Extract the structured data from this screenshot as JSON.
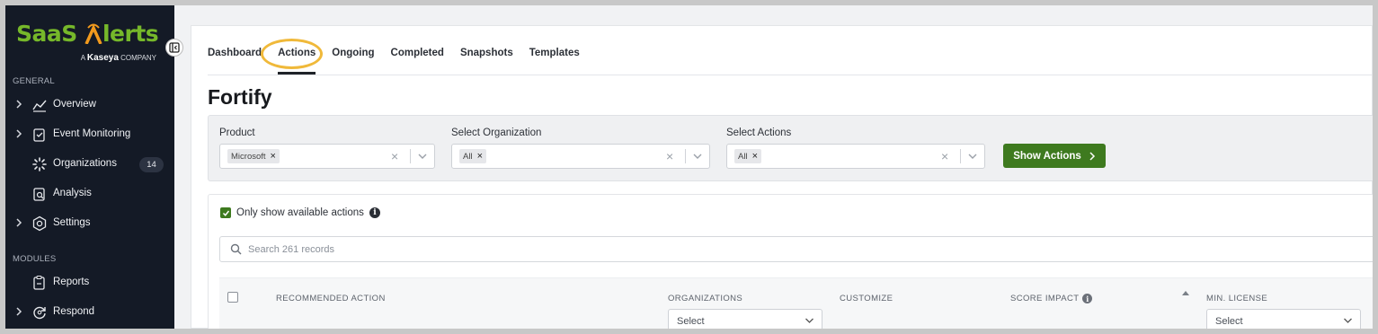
{
  "brand": {
    "name_part1": "SaaS",
    "name_part2": "lerts",
    "tagline_prefix": "A",
    "tagline_company": "Kaseya",
    "tagline_suffix": "COMPANY"
  },
  "sidebar": {
    "sections": {
      "general": "GENERAL",
      "modules": "MODULES"
    },
    "items": [
      {
        "label": "Overview",
        "icon": "chart-line-icon",
        "expandable": true
      },
      {
        "label": "Event Monitoring",
        "icon": "clipboard-check-icon",
        "expandable": true
      },
      {
        "label": "Organizations",
        "icon": "loader-dots-icon",
        "expandable": false,
        "badge": "14"
      },
      {
        "label": "Analysis",
        "icon": "clipboard-search-icon",
        "expandable": false
      },
      {
        "label": "Settings",
        "icon": "gear-hex-icon",
        "expandable": true
      },
      {
        "label": "Reports",
        "icon": "clipboard-icon",
        "expandable": false
      },
      {
        "label": "Respond",
        "icon": "refresh-cycle-icon",
        "expandable": true
      }
    ]
  },
  "tabs": [
    {
      "label": "Dashboard",
      "active": false
    },
    {
      "label": "Actions",
      "active": true
    },
    {
      "label": "Ongoing",
      "active": false
    },
    {
      "label": "Completed",
      "active": false
    },
    {
      "label": "Snapshots",
      "active": false
    },
    {
      "label": "Templates",
      "active": false
    }
  ],
  "page_title": "Fortify",
  "filters": {
    "product": {
      "label": "Product",
      "chip": "Microsoft"
    },
    "organization": {
      "label": "Select Organization",
      "chip": "All"
    },
    "actions": {
      "label": "Select Actions",
      "chip": "All"
    },
    "show_button": "Show Actions"
  },
  "options": {
    "only_available_label": "Only show available actions",
    "only_available_checked": true
  },
  "search": {
    "placeholder": "Search 261 records"
  },
  "table": {
    "columns": {
      "recommended_action": "RECOMMENDED ACTION",
      "organizations": "ORGANIZATIONS",
      "customize": "CUSTOMIZE",
      "score_impact": "SCORE IMPACT",
      "min_license": "MIN. LICENSE"
    },
    "filter_placeholder": "Select"
  },
  "colors": {
    "sidebar_bg": "#141a26",
    "brand_green": "#76b82a",
    "brand_orange": "#f29a1d",
    "primary_button": "#3e7a1f",
    "highlight_ring": "#f0b93a"
  }
}
